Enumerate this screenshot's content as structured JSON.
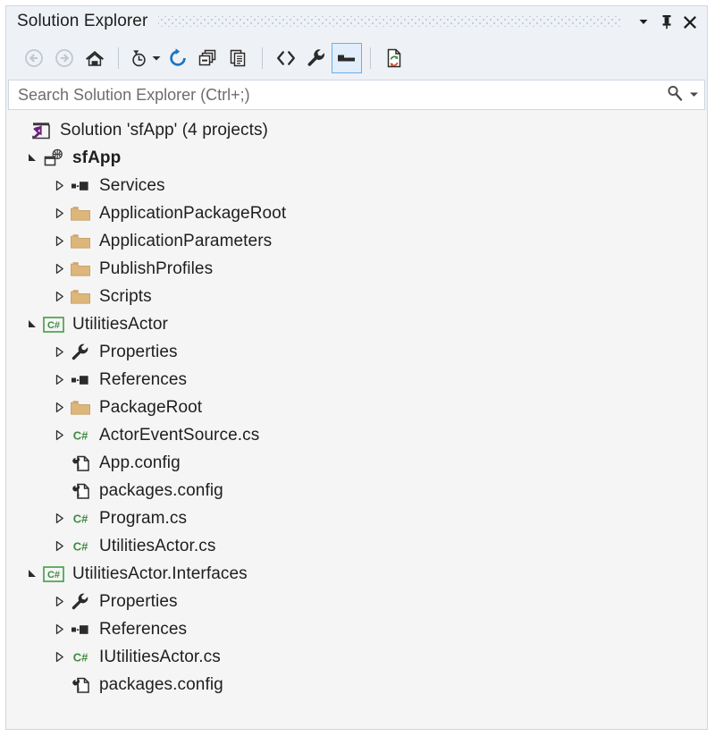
{
  "window": {
    "title": "Solution Explorer",
    "buttons": [
      {
        "name": "window-dropdown-button",
        "icon": "chevron-down-icon"
      },
      {
        "name": "pin-button",
        "icon": "pin-icon"
      },
      {
        "name": "close-button",
        "icon": "close-icon"
      }
    ]
  },
  "toolbar": {
    "items": [
      {
        "name": "back-button",
        "icon": "back-arrow-icon",
        "tooltip": "Back",
        "enabled": false,
        "selected": false
      },
      {
        "name": "forward-button",
        "icon": "forward-arrow-icon",
        "tooltip": "Forward",
        "enabled": false,
        "selected": false
      },
      {
        "name": "home-button",
        "icon": "home-icon",
        "tooltip": "Home",
        "enabled": true,
        "selected": false
      },
      {
        "name": "pending-changes-button",
        "icon": "clock-filter-icon",
        "tooltip": "Pending Changes Filter",
        "enabled": true,
        "selected": false
      },
      {
        "name": "refresh-button",
        "icon": "refresh-icon",
        "tooltip": "Refresh",
        "enabled": true,
        "selected": false
      },
      {
        "name": "collapse-all-button",
        "icon": "collapse-all-icon",
        "tooltip": "Collapse All",
        "enabled": true,
        "selected": false
      },
      {
        "name": "show-all-files-button",
        "icon": "show-all-files-icon",
        "tooltip": "Show All Files",
        "enabled": true,
        "selected": false
      },
      {
        "name": "view-code-button",
        "icon": "code-angle-brackets-icon",
        "tooltip": "View Code",
        "enabled": true,
        "selected": false
      },
      {
        "name": "properties-button",
        "icon": "wrench-icon",
        "tooltip": "Properties",
        "enabled": true,
        "selected": false
      },
      {
        "name": "preview-selected-button",
        "icon": "preview-pane-icon",
        "tooltip": "Preview Selected Items",
        "enabled": true,
        "selected": true
      },
      {
        "name": "sync-with-document-button",
        "icon": "sync-document-icon",
        "tooltip": "Sync with Active Document",
        "enabled": true,
        "selected": false
      }
    ]
  },
  "search": {
    "placeholder": "Search Solution Explorer (Ctrl+;)",
    "value": "",
    "icon": "magnifier-icon",
    "dropdown_icon": "chevron-down-icon"
  },
  "tree": {
    "rows": [
      {
        "name": "solution-node",
        "label": "Solution 'sfApp' (4 projects)",
        "indent": 0,
        "twisty": "none",
        "icon": "visual-studio-solution-icon",
        "bold": false
      },
      {
        "name": "project-sfapp",
        "label": "sfApp",
        "indent": 1,
        "twisty": "expanded",
        "icon": "service-fabric-app-icon",
        "bold": true
      },
      {
        "name": "node-services",
        "label": "Services",
        "indent": 2,
        "twisty": "collapsed",
        "icon": "references-icon",
        "bold": false
      },
      {
        "name": "folder-applicationpackageroot",
        "label": "ApplicationPackageRoot",
        "indent": 2,
        "twisty": "collapsed",
        "icon": "folder-icon",
        "bold": false
      },
      {
        "name": "folder-applicationparameters",
        "label": "ApplicationParameters",
        "indent": 2,
        "twisty": "collapsed",
        "icon": "folder-icon",
        "bold": false
      },
      {
        "name": "folder-publishprofiles",
        "label": "PublishProfiles",
        "indent": 2,
        "twisty": "collapsed",
        "icon": "folder-icon",
        "bold": false
      },
      {
        "name": "folder-scripts",
        "label": "Scripts",
        "indent": 2,
        "twisty": "collapsed",
        "icon": "folder-icon",
        "bold": false
      },
      {
        "name": "project-utilitiesactor",
        "label": "UtilitiesActor",
        "indent": 1,
        "twisty": "expanded",
        "icon": "csharp-project-icon",
        "bold": false
      },
      {
        "name": "node-properties-1",
        "label": "Properties",
        "indent": 2,
        "twisty": "collapsed",
        "icon": "wrench-icon",
        "bold": false
      },
      {
        "name": "node-references-1",
        "label": "References",
        "indent": 2,
        "twisty": "collapsed",
        "icon": "references-icon",
        "bold": false
      },
      {
        "name": "folder-packageroot",
        "label": "PackageRoot",
        "indent": 2,
        "twisty": "collapsed",
        "icon": "folder-icon",
        "bold": false
      },
      {
        "name": "file-actoreventsource-cs",
        "label": "ActorEventSource.cs",
        "indent": 2,
        "twisty": "collapsed",
        "icon": "csharp-file-icon",
        "bold": false
      },
      {
        "name": "file-app-config",
        "label": "App.config",
        "indent": 2,
        "twisty": "none",
        "icon": "config-file-icon",
        "bold": false
      },
      {
        "name": "file-packages-config-1",
        "label": "packages.config",
        "indent": 2,
        "twisty": "none",
        "icon": "config-file-icon",
        "bold": false
      },
      {
        "name": "file-program-cs",
        "label": "Program.cs",
        "indent": 2,
        "twisty": "collapsed",
        "icon": "csharp-file-icon",
        "bold": false
      },
      {
        "name": "file-utilitiesactor-cs",
        "label": "UtilitiesActor.cs",
        "indent": 2,
        "twisty": "collapsed",
        "icon": "csharp-file-icon",
        "bold": false
      },
      {
        "name": "project-utilitiesactor-interfaces",
        "label": "UtilitiesActor.Interfaces",
        "indent": 1,
        "twisty": "expanded",
        "icon": "csharp-project-icon",
        "bold": false
      },
      {
        "name": "node-properties-2",
        "label": "Properties",
        "indent": 2,
        "twisty": "collapsed",
        "icon": "wrench-icon",
        "bold": false
      },
      {
        "name": "node-references-2",
        "label": "References",
        "indent": 2,
        "twisty": "collapsed",
        "icon": "references-icon",
        "bold": false
      },
      {
        "name": "file-iutilitiesactor-cs",
        "label": "IUtilitiesActor.cs",
        "indent": 2,
        "twisty": "collapsed",
        "icon": "csharp-file-icon",
        "bold": false
      },
      {
        "name": "file-packages-config-2",
        "label": "packages.config",
        "indent": 2,
        "twisty": "none",
        "icon": "config-file-icon",
        "bold": false
      }
    ]
  },
  "colors": {
    "window_bg": "#eef1f5",
    "tree_bg": "#f5f5f5",
    "border": "#cfd6e4",
    "text": "#1e1e1e",
    "placeholder": "#6e6e6e",
    "folder": "#dcb67a",
    "csharp_green": "#3d8b40",
    "refresh_blue": "#1a74c4",
    "vs_purple": "#68217a",
    "selected_border": "#6aaee8",
    "selected_bg": "#e2eefb"
  },
  "cs_label": "C#"
}
